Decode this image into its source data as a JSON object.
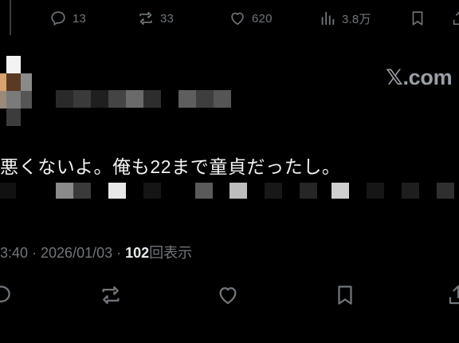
{
  "top_actions": {
    "replies": "13",
    "reposts": "33",
    "likes": "620",
    "views": "3.8万"
  },
  "watermark": "𝕏.com",
  "tweet": {
    "text": "悪くないよ。俺も22まで童貞だったし。",
    "timestamp": "3:40 · 2026/01/03 · ",
    "views_count": "102",
    "views_label": "回表示"
  },
  "colors": {
    "background": "#000000",
    "muted": "#71767b",
    "text": "#e7e9ea"
  },
  "icons": [
    "reply-icon",
    "repost-icon",
    "like-icon",
    "views-icon",
    "bookmark-icon"
  ]
}
